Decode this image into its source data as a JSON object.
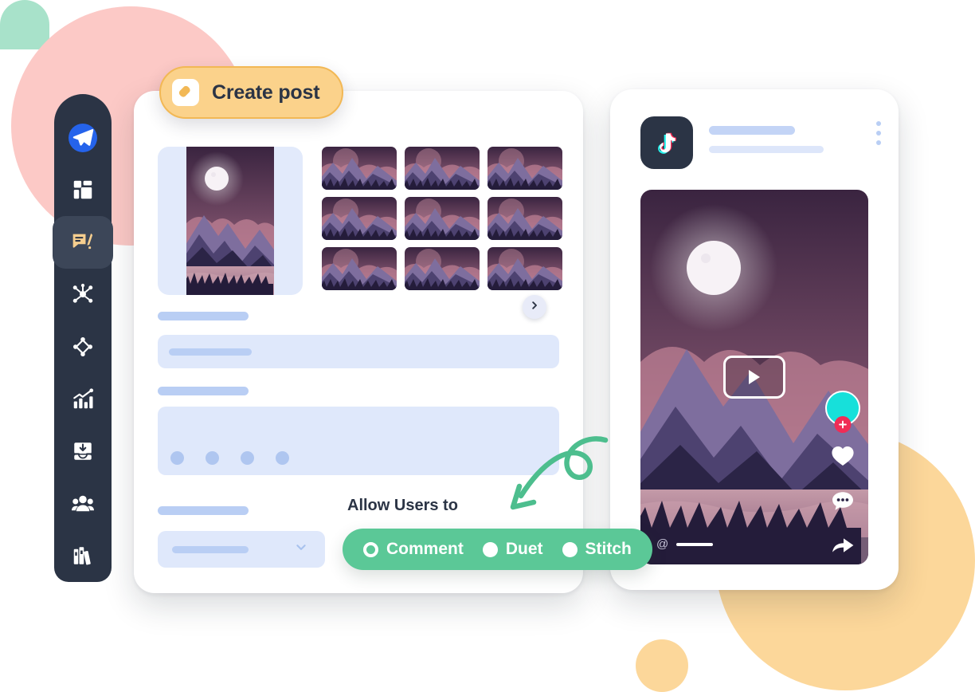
{
  "badge": {
    "label": "Create post",
    "icon": "pen-icon",
    "bg_color": "#FBD28B",
    "border_color": "#F2B855",
    "text_color": "#2B3445"
  },
  "sidebar": {
    "bg_color": "#2B3445",
    "active_bg_color": "#3C4658",
    "items": [
      {
        "name": "logo",
        "icon": "paper-plane-icon",
        "active": false
      },
      {
        "name": "dashboard",
        "icon": "grid-dashboard-icon",
        "active": false
      },
      {
        "name": "posts",
        "icon": "compose-message-icon",
        "active": true
      },
      {
        "name": "network",
        "icon": "network-hub-icon",
        "active": false
      },
      {
        "name": "nodes",
        "icon": "diamond-nodes-icon",
        "active": false
      },
      {
        "name": "analytics",
        "icon": "growth-chart-icon",
        "active": false
      },
      {
        "name": "inbox",
        "icon": "inbox-download-icon",
        "active": false
      },
      {
        "name": "audience",
        "icon": "users-group-icon",
        "active": false
      },
      {
        "name": "library",
        "icon": "books-library-icon",
        "active": false
      }
    ]
  },
  "composer": {
    "gallery": {
      "selected_index": 0,
      "thumbnail_count": 9,
      "next_button_icon": "chevron-right-icon"
    },
    "fields": [
      {
        "name": "title-field",
        "type": "input",
        "label_placeholder": "",
        "value_placeholder": ""
      },
      {
        "name": "description-field",
        "type": "textarea",
        "label_placeholder": "",
        "value_placeholder": ""
      },
      {
        "name": "privacy-select",
        "type": "select",
        "label_placeholder": "",
        "value_placeholder": "",
        "icon": "chevron-down-icon"
      }
    ],
    "emoji_dot_count": 4
  },
  "allow_users": {
    "title": "Allow Users to",
    "pill_color": "#5BC897",
    "options": [
      {
        "label": "Comment",
        "selected": true,
        "marker": "ring"
      },
      {
        "label": "Duet",
        "selected": false,
        "marker": "dot"
      },
      {
        "label": "Stitch",
        "selected": false,
        "marker": "dot"
      }
    ]
  },
  "arrow": {
    "name": "curly-arrow",
    "color": "#4DBE8E",
    "direction": "down-left"
  },
  "preview": {
    "platform": "TikTok",
    "logo_icon": "tiktok-logo-icon",
    "menu_icon": "kebab-menu-icon",
    "video": {
      "play_icon": "play-button-icon",
      "handle_prefix": "@"
    },
    "actions": [
      {
        "name": "avatar",
        "icon": "avatar-icon",
        "badge_icon": "plus-icon",
        "color": "#17E0DA",
        "badge_color": "#F02C56"
      },
      {
        "name": "like",
        "icon": "heart-icon"
      },
      {
        "name": "comment",
        "icon": "comment-bubble-icon"
      },
      {
        "name": "share",
        "icon": "share-arrow-icon"
      }
    ]
  },
  "decor": {
    "pink_circle": "#FCC9C6",
    "orange_circle": "#FCD79A",
    "mint_shape": "#A8E2CA"
  }
}
